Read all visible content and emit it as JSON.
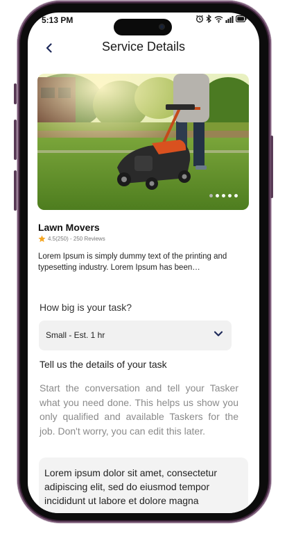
{
  "status_bar": {
    "time": "5:13 PM"
  },
  "header": {
    "title": "Service Details"
  },
  "service": {
    "title": "Lawn Movers",
    "rating_text": "4.5(250) - 250 Reviews",
    "description": "Lorem Ipsum is simply dummy text of the printing and typesetting industry. Lorem Ipsum has been…"
  },
  "carousel": {
    "dot_count": 5,
    "active_index": 1
  },
  "task_size": {
    "label": "How big is your task?",
    "selected": "Small - Est. 1 hr"
  },
  "details": {
    "label": "Tell us the details of your task",
    "helper": "Start the conversation and tell your Tasker what you need done. This helps us show you only qualified and available Taskers for the job. Don't worry, you can edit this later.",
    "value": "Lorem ipsum dolor sit amet, consectetur adipiscing elit, sed do eiusmod tempor incididunt ut labore et dolore magna"
  },
  "colors": {
    "accent": "#1e2a5a",
    "star": "#f5a623",
    "frame": "#3a2237"
  }
}
